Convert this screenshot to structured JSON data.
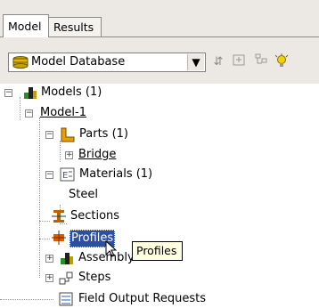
{
  "tabs": {
    "model": "Model",
    "results": "Results"
  },
  "toolbar": {
    "database_label": "Model Database"
  },
  "tree": {
    "models": "Models (1)",
    "model1": "Model-1",
    "parts": "Parts (1)",
    "bridge": "Bridge",
    "materials": "Materials (1)",
    "steel": "Steel",
    "sections": "Sections",
    "profiles": "Profiles",
    "assembly": "Assembly",
    "steps": "Steps",
    "field_output": "Field Output Requests"
  },
  "tooltip": "Profiles"
}
